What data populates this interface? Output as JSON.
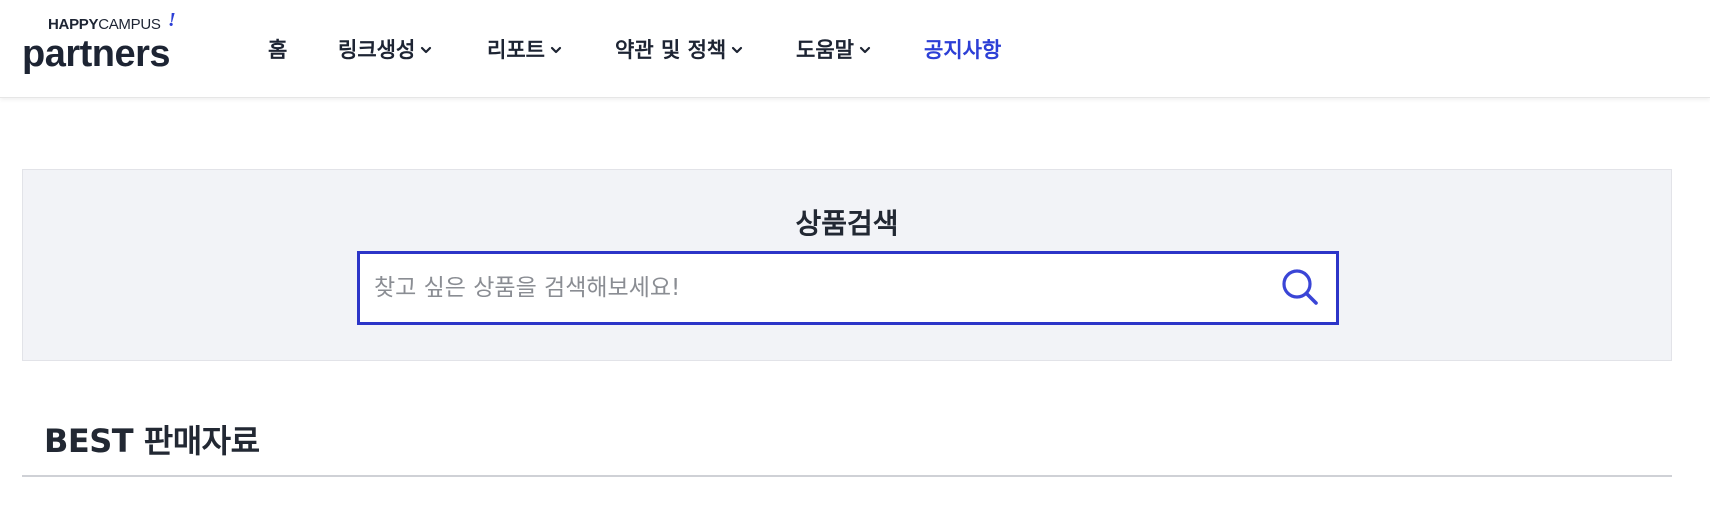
{
  "brand": {
    "top_bold": "HAPPY",
    "top_light": "CAMPUS",
    "mark": "!",
    "name": "partners"
  },
  "nav": {
    "items": [
      {
        "label": "홈",
        "has_dropdown": false
      },
      {
        "label": "링크생성",
        "has_dropdown": true
      },
      {
        "label": "리포트",
        "has_dropdown": true
      },
      {
        "label": "약관 및 정책",
        "has_dropdown": true
      },
      {
        "label": "도움말",
        "has_dropdown": true
      },
      {
        "label": "공지사항",
        "has_dropdown": false,
        "active": true
      }
    ]
  },
  "search": {
    "title": "상품검색",
    "placeholder": "찾고 싶은 상품을 검색해보세요!",
    "value": "",
    "icon": "search-icon"
  },
  "best": {
    "title": "BEST 판매자료"
  },
  "colors": {
    "accent": "#2c35c8",
    "active_nav": "#2c3fd6",
    "text": "#1d2433",
    "panel_bg": "#f2f3f7"
  }
}
